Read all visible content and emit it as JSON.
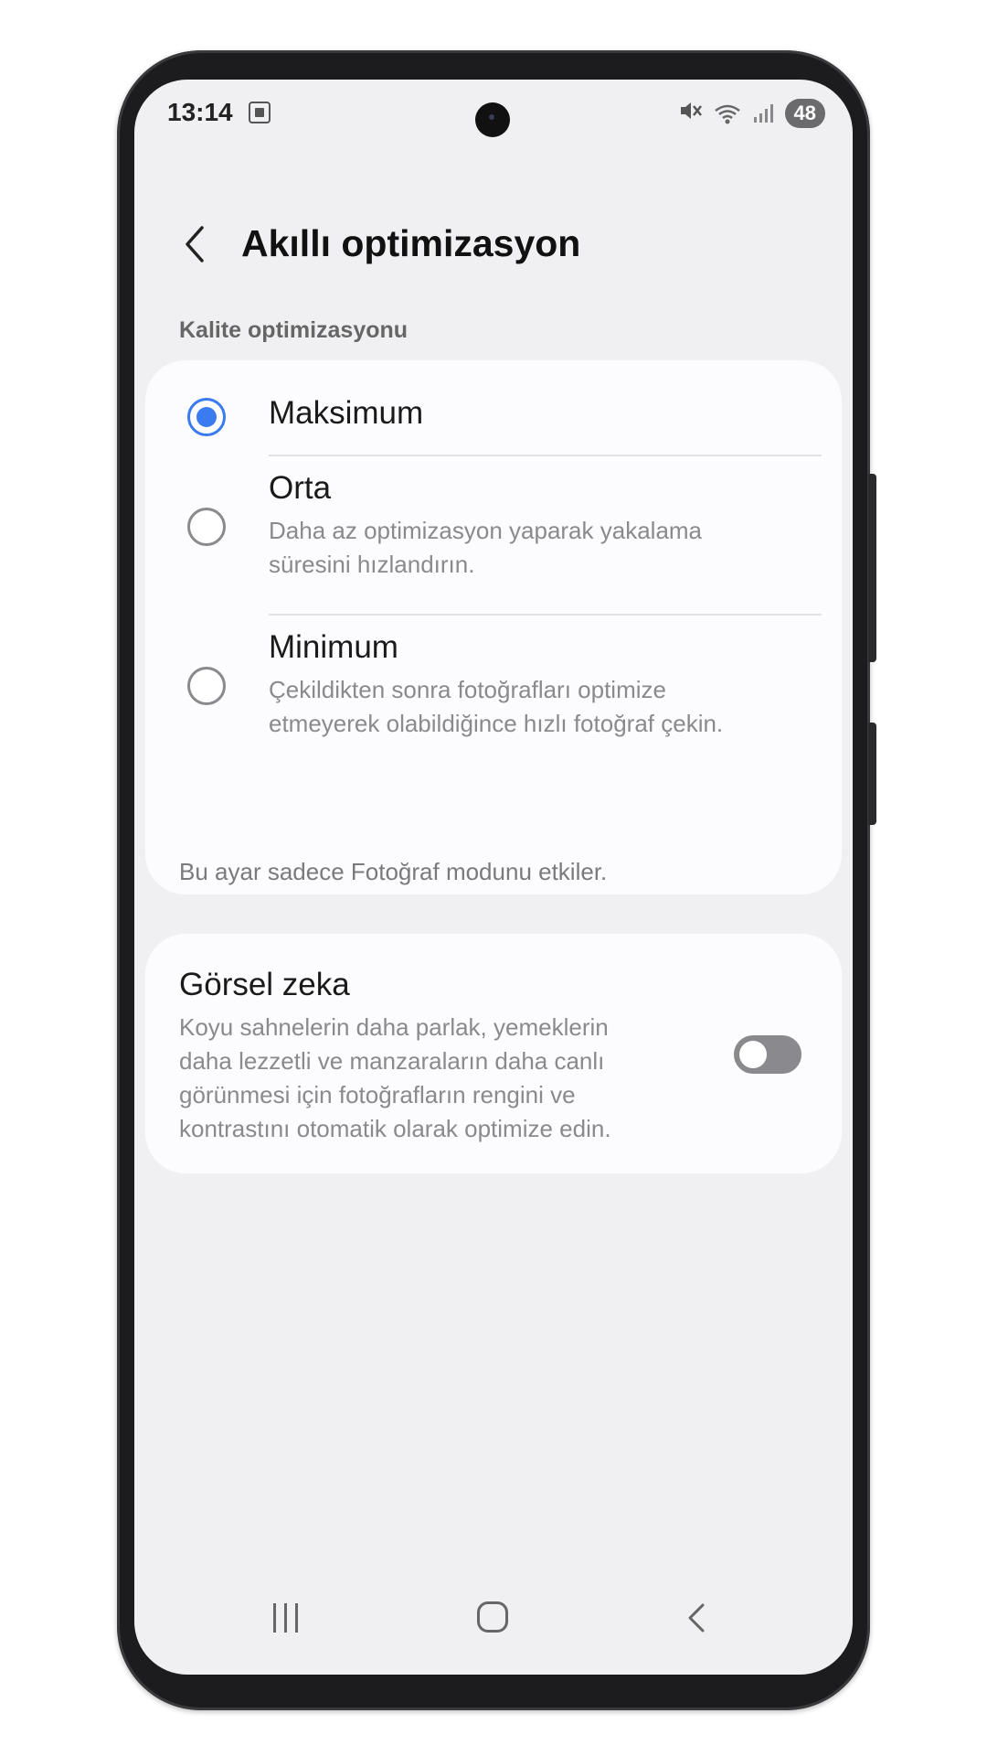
{
  "status_bar": {
    "time": "13:14",
    "battery": "48",
    "icons": [
      "screenshot-icon",
      "mute-icon",
      "wifi-icon",
      "signal-icon"
    ]
  },
  "header": {
    "title": "Akıllı optimizasyon"
  },
  "quality_section": {
    "label": "Kalite optimizasyonu",
    "options": [
      {
        "title": "Maksimum",
        "description": "",
        "selected": true
      },
      {
        "title": "Orta",
        "description_line1": "Daha az optimizasyon yaparak yakalama",
        "description_line2": "süresini hızlandırın.",
        "selected": false
      },
      {
        "title": "Minimum",
        "description_line1": "Çekildikten sonra fotoğrafları optimize",
        "description_line2": "etmeyerek olabildiğince hızlı fotoğraf çekin.",
        "selected": false
      }
    ],
    "footnote": "Bu ayar sadece Fotoğraf modunu etkiler."
  },
  "visual_ai": {
    "title": "Görsel zeka",
    "description_lines": [
      "Koyu sahnelerin daha parlak, yemeklerin",
      "daha lezzetli ve manzaraların daha canlı",
      "görünmesi için fotoğrafların rengini ve",
      "kontrastını otomatik olarak optimize edin."
    ],
    "enabled": false
  },
  "colors": {
    "accent": "#3a7bf0",
    "background": "#f0f0f2",
    "card": "#fcfcfe"
  }
}
